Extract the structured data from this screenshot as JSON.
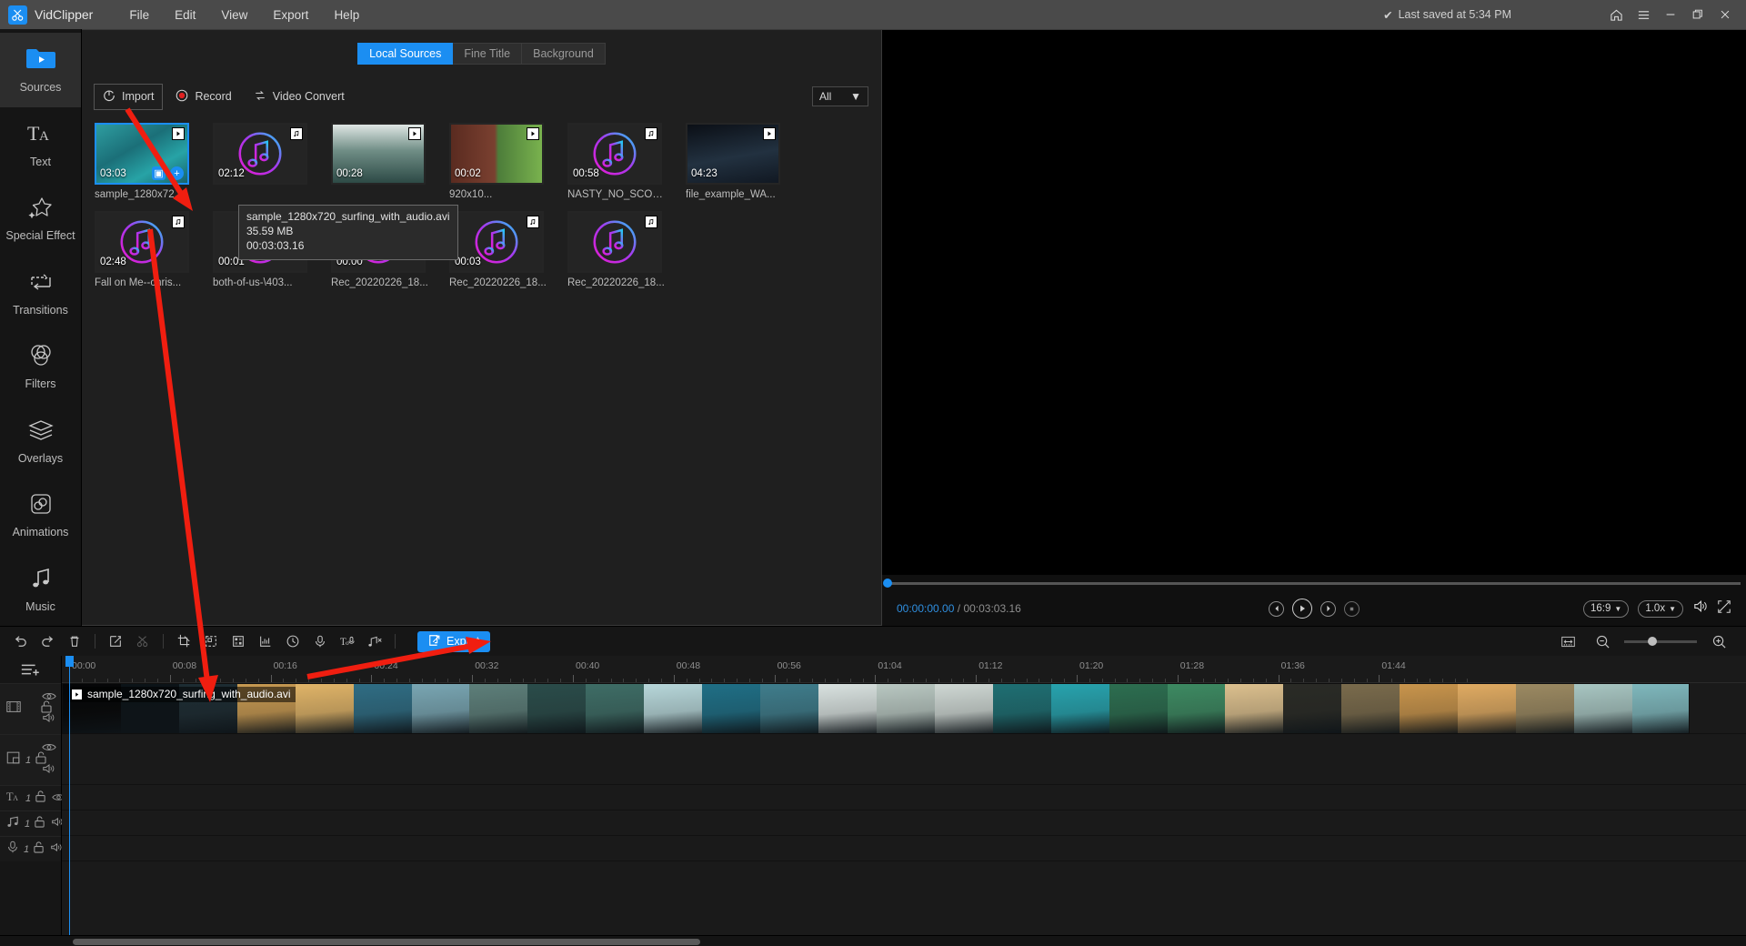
{
  "titlebar": {
    "app_name": "VidClipper",
    "menus": [
      "File",
      "Edit",
      "View",
      "Export",
      "Help"
    ],
    "saved_text": "Last saved at 5:34 PM",
    "check_icon": "✔",
    "window_buttons": [
      "home-icon",
      "menu-icon",
      "minimize-icon",
      "restore-icon",
      "close-icon"
    ],
    "accent": "#1b8ef2"
  },
  "sidebar": {
    "items": [
      {
        "label": "Sources",
        "icon": "folder-video-icon",
        "active": true
      },
      {
        "label": "Text",
        "icon": "text-icon",
        "active": false
      },
      {
        "label": "Special Effect",
        "icon": "sparkle-icon",
        "active": false
      },
      {
        "label": "Transitions",
        "icon": "transition-icon",
        "active": false
      },
      {
        "label": "Filters",
        "icon": "filters-icon",
        "active": false
      },
      {
        "label": "Overlays",
        "icon": "layers-icon",
        "active": false
      },
      {
        "label": "Animations",
        "icon": "animation-icon",
        "active": false
      },
      {
        "label": "Music",
        "icon": "music-note-icon",
        "active": false
      }
    ]
  },
  "sources": {
    "tabs": [
      {
        "label": "Local Sources",
        "active": true
      },
      {
        "label": "Fine Title",
        "active": false
      },
      {
        "label": "Background",
        "active": false
      }
    ],
    "toolbar": [
      {
        "label": "Import",
        "icon": "import-icon"
      },
      {
        "label": "Record",
        "icon": "record-icon"
      },
      {
        "label": "Video Convert",
        "icon": "convert-icon"
      }
    ],
    "filter": {
      "value": "All",
      "caret": "▼"
    },
    "media": [
      {
        "name": "sample_1280x72...",
        "duration": "03:03",
        "type": "video",
        "selected": true,
        "art": "ocean-aerial"
      },
      {
        "name": "",
        "duration": "02:12",
        "type": "audio",
        "selected": false,
        "art": "audio"
      },
      {
        "name": "",
        "duration": "00:28",
        "type": "video",
        "selected": false,
        "art": "rocks-surf"
      },
      {
        "name": "920x10...",
        "duration": "00:02",
        "type": "video",
        "selected": false,
        "art": "game"
      },
      {
        "name": "NASTY_NO_SCOP...",
        "duration": "00:58",
        "type": "audio",
        "selected": false,
        "art": "audio"
      },
      {
        "name": "file_example_WA...",
        "duration": "04:23",
        "type": "video",
        "selected": false,
        "art": "dark-scene"
      },
      {
        "name": "Fall on Me--chris...",
        "duration": "02:48",
        "type": "audio",
        "selected": false,
        "art": "audio"
      },
      {
        "name": "both-of-us-\\403...",
        "duration": "00:01",
        "type": "audio",
        "selected": false,
        "art": "audio"
      },
      {
        "name": "Rec_20220226_18...",
        "duration": "00:00",
        "type": "audio",
        "selected": false,
        "art": "audio"
      },
      {
        "name": "Rec_20220226_18...",
        "duration": "00:03",
        "type": "audio",
        "selected": false,
        "art": "audio"
      },
      {
        "name": "Rec_20220226_18...",
        "duration": "",
        "type": "audio",
        "selected": false,
        "art": "audio"
      }
    ],
    "tooltip": {
      "filename": "sample_1280x720_surfing_with_audio.avi",
      "size": "35.59 MB",
      "duration": "00:03:03.16"
    }
  },
  "preview": {
    "current_time": "00:00:00.00",
    "separator": "/",
    "total_time": "00:03:03.16",
    "controls": [
      "prev-frame-button",
      "play-button",
      "next-frame-button",
      "stop-button"
    ],
    "aspect_ratio": "16:9",
    "speed": "1.0x",
    "caret": "▼",
    "volume_icon": "volume-icon",
    "fullscreen_icon": "fullscreen-icon"
  },
  "timeline": {
    "tools": [
      "undo-icon",
      "redo-icon",
      "delete-icon",
      "edit-icon",
      "cut-icon",
      "crop-icon",
      "resize-icon",
      "mosaic-icon",
      "audio-level-icon",
      "speed-icon",
      "voiceover-icon",
      "text-to-speech-icon",
      "audio-detach-icon"
    ],
    "export_label": "Export",
    "zoom_tools": [
      "fit-timeline-icon",
      "zoom-out-icon",
      "zoom-slider",
      "zoom-in-icon"
    ],
    "ruler_ticks": [
      "00:00",
      "00:08",
      "00:16",
      "00:24",
      "00:32",
      "00:40",
      "00:48",
      "00:56",
      "01:04",
      "01:12",
      "01:20",
      "01:28",
      "01:36",
      "01:44"
    ],
    "tracks": [
      {
        "type": "video",
        "icon": "film-icon",
        "number": "",
        "lock": "unlock-icon",
        "eye": "eye-icon",
        "speaker": "speaker-icon"
      },
      {
        "type": "pip",
        "icon": "pip-icon",
        "number": "1",
        "lock": "unlock-icon",
        "eye": "eye-icon",
        "speaker": "speaker-icon"
      },
      {
        "type": "text",
        "icon": "text-icon",
        "number": "1",
        "lock": "unlock-icon",
        "eye": "eye-icon",
        "speaker": ""
      },
      {
        "type": "music",
        "icon": "music-note-icon",
        "number": "1",
        "lock": "unlock-icon",
        "eye": "",
        "speaker": "speaker-icon"
      },
      {
        "type": "voice",
        "icon": "mic-icon",
        "number": "1",
        "lock": "unlock-icon",
        "eye": "",
        "speaker": "speaker-icon"
      }
    ],
    "clip": {
      "label": "sample_1280x720_surfing_with_audio.avi"
    },
    "add_track_icon": "add-track-icon"
  }
}
